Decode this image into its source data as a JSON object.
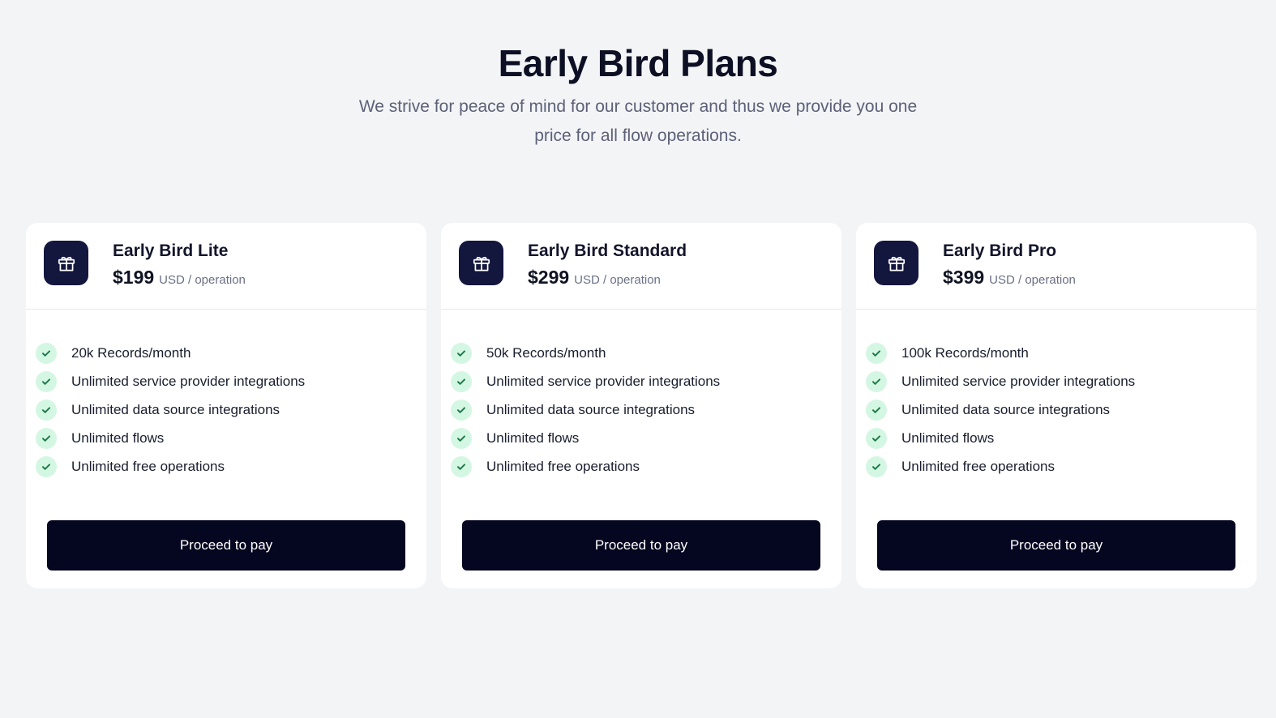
{
  "header": {
    "title": "Early Bird Plans",
    "subtitle": "We strive for peace of mind for our customer and thus we provide you one price for all flow operations."
  },
  "colors": {
    "background": "#f3f4f6",
    "card": "#ffffff",
    "icon_badge": "#13163d",
    "button": "#05061f",
    "check_bg": "#d4f7e3",
    "check_mark": "#1f7a4a"
  },
  "plans": [
    {
      "icon": "gift-icon",
      "name": "Early Bird Lite",
      "price": "$199",
      "unit": "USD / operation",
      "features": [
        "20k Records/month",
        "Unlimited service provider integrations",
        "Unlimited data source integrations",
        "Unlimited flows",
        "Unlimited free operations"
      ],
      "button_label": "Proceed to pay"
    },
    {
      "icon": "gift-icon",
      "name": "Early Bird Standard",
      "price": "$299",
      "unit": "USD / operation",
      "features": [
        "50k Records/month",
        "Unlimited service provider integrations",
        "Unlimited data source integrations",
        "Unlimited flows",
        "Unlimited free operations"
      ],
      "button_label": "Proceed to pay"
    },
    {
      "icon": "gift-icon",
      "name": "Early Bird Pro",
      "price": "$399",
      "unit": "USD / operation",
      "features": [
        "100k Records/month",
        "Unlimited service provider integrations",
        "Unlimited data source integrations",
        "Unlimited flows",
        "Unlimited free operations"
      ],
      "button_label": "Proceed to pay"
    }
  ]
}
